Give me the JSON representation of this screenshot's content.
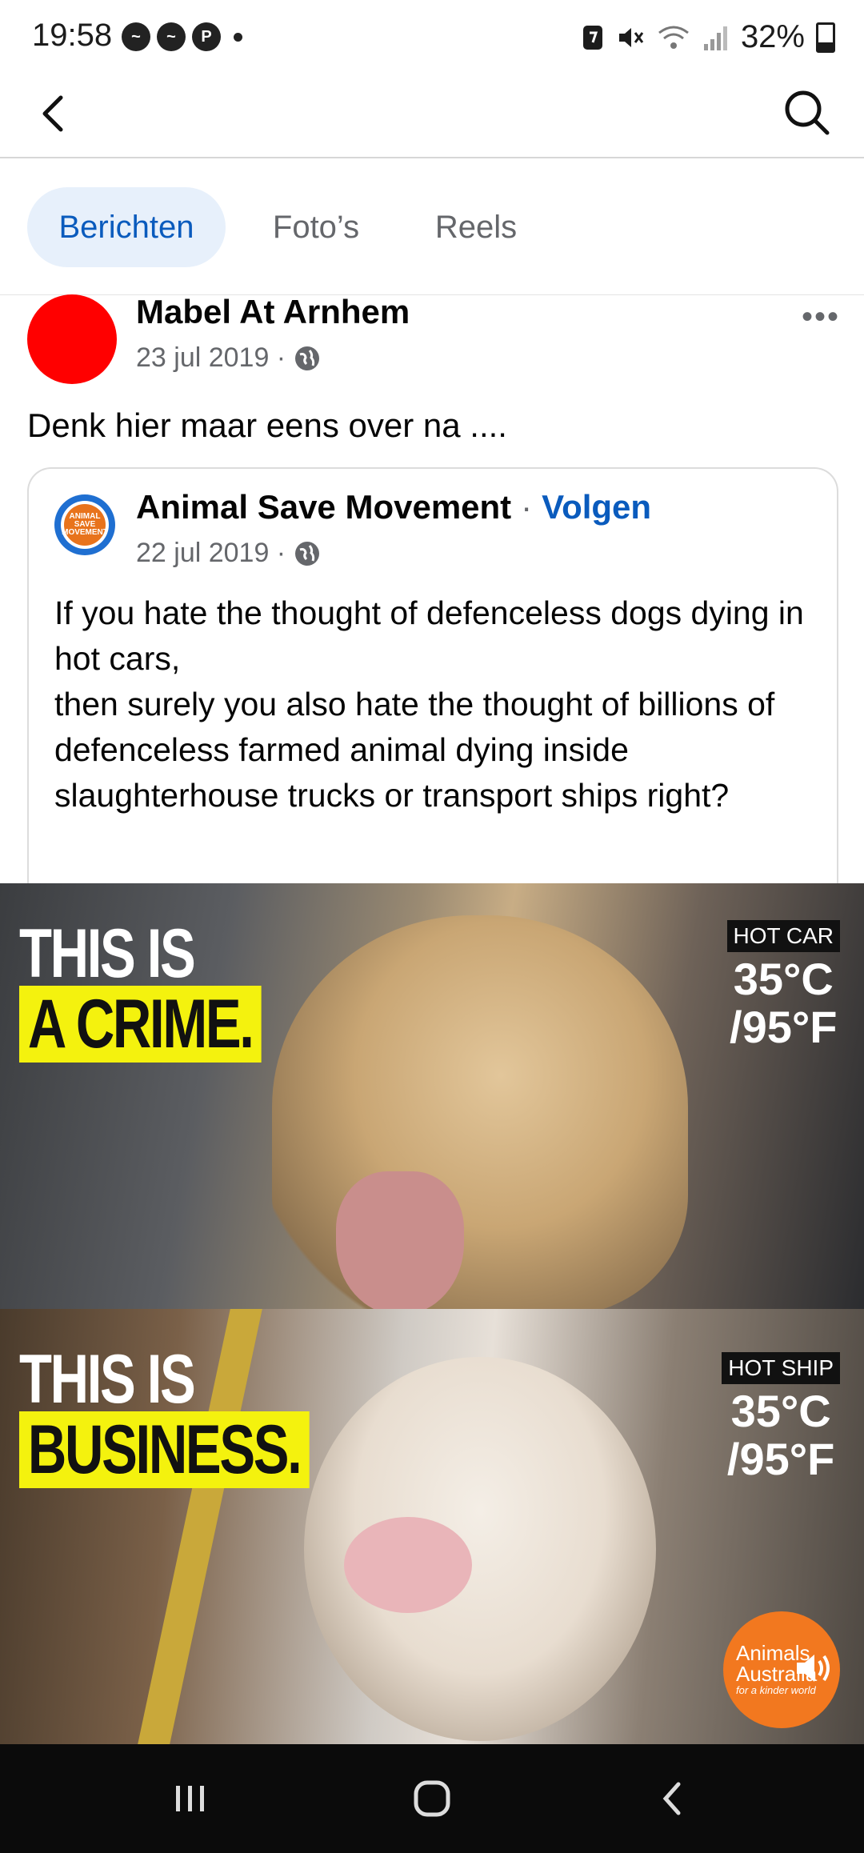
{
  "status_bar": {
    "time": "19:58",
    "notification_icons": [
      "messenger-icon",
      "messenger-icon",
      "pinterest-icon"
    ],
    "battery": "32%"
  },
  "tabs": [
    {
      "label": "Berichten",
      "active": true
    },
    {
      "label": "Foto’s",
      "active": false
    },
    {
      "label": "Reels",
      "active": false
    }
  ],
  "post": {
    "author": "Mabel At Arnhem",
    "date": "23 jul 2019 · ",
    "message": "Denk hier maar eens over na ....",
    "avatar_color": "#ff0000"
  },
  "shared": {
    "page_name": "Animal Save Movement",
    "separator": "·",
    "follow_label": "Volgen",
    "date": "22 jul 2019 · ",
    "logo_text": "ANIMAL SAVE MOVEMENT",
    "text": "If you hate the thought of defenceless dogs dying in hot cars,\nthen surely you also hate the thought of billions of defenceless farmed animal dying inside slaughterhouse trucks or transport ships right?"
  },
  "media": {
    "top": {
      "line1": "THIS IS",
      "line2": "A CRIME.",
      "label": "HOT CAR",
      "temp_c": "35°C",
      "temp_f": "/95°F"
    },
    "bottom": {
      "line1": "THIS IS",
      "line2": "BUSINESS.",
      "label": "HOT SHIP",
      "temp_c": "35°C",
      "temp_f": "/95°F"
    },
    "watermark": {
      "line1": "Animals",
      "line2": "Australia",
      "tagline": "for a kinder world"
    }
  },
  "colors": {
    "accent": "#0a5bbd",
    "tab_active_bg": "#e7f0fb",
    "highlight_yellow": "#f4f20e",
    "watermark_orange": "#f2781f"
  }
}
